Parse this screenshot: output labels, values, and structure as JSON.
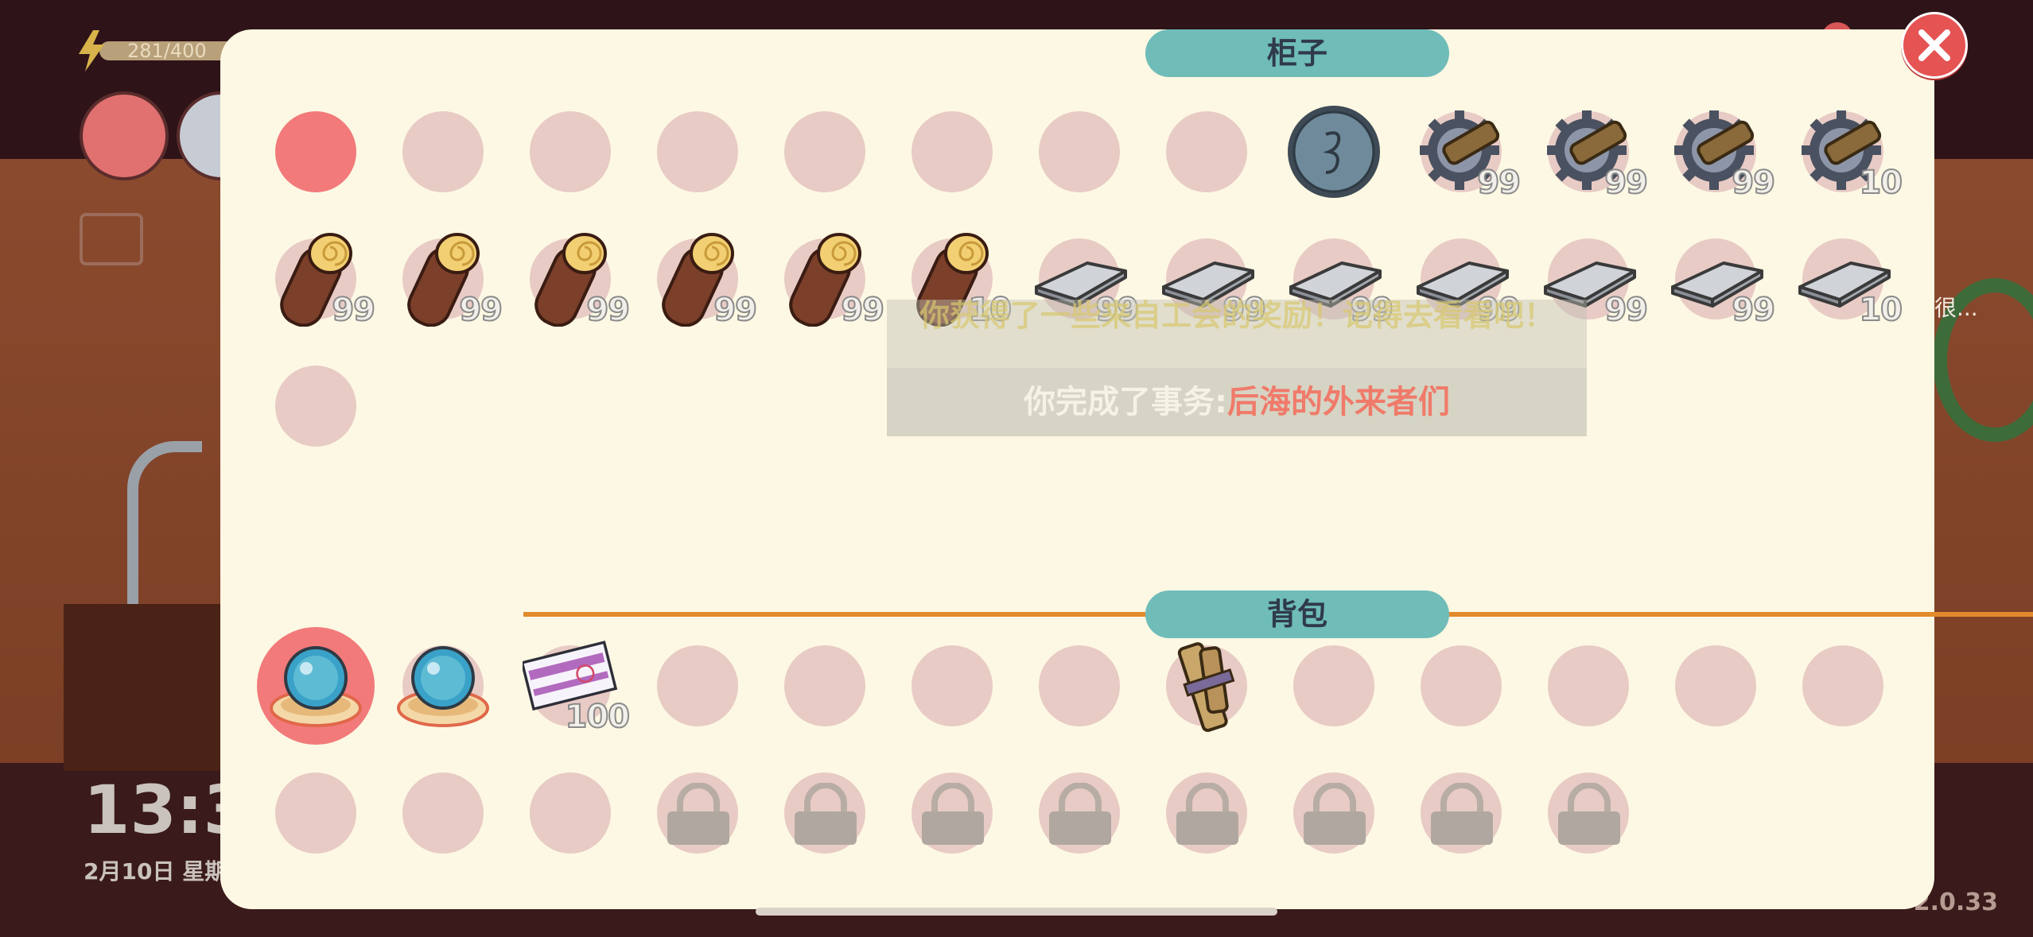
{
  "hud": {
    "energy_text": "281/400",
    "clock": "13:3",
    "date": "2月10日 星期",
    "version": "2.0.33",
    "side_hint": "很..."
  },
  "panel": {
    "chest_title": "柜子",
    "bag_title": "背包"
  },
  "chest_slots": [
    {
      "item": "empty-selected",
      "count": ""
    },
    {
      "item": "empty",
      "count": ""
    },
    {
      "item": "empty",
      "count": ""
    },
    {
      "item": "empty",
      "count": ""
    },
    {
      "item": "empty",
      "count": ""
    },
    {
      "item": "empty",
      "count": ""
    },
    {
      "item": "empty",
      "count": ""
    },
    {
      "item": "empty",
      "count": ""
    },
    {
      "item": "blue-coin",
      "count": ""
    },
    {
      "item": "gear",
      "count": "99"
    },
    {
      "item": "gear",
      "count": "99"
    },
    {
      "item": "gear",
      "count": "99"
    },
    {
      "item": "gear",
      "count": "10"
    },
    {
      "item": "log",
      "count": "99"
    },
    {
      "item": "log",
      "count": "99"
    },
    {
      "item": "log",
      "count": "99"
    },
    {
      "item": "log",
      "count": "99"
    },
    {
      "item": "log",
      "count": "99"
    },
    {
      "item": "log",
      "count": "10"
    },
    {
      "item": "metal-plate",
      "count": "99"
    },
    {
      "item": "metal-plate",
      "count": "99"
    },
    {
      "item": "metal-plate",
      "count": "99"
    },
    {
      "item": "metal-plate",
      "count": "99"
    },
    {
      "item": "metal-plate",
      "count": "99"
    },
    {
      "item": "metal-plate",
      "count": "99"
    },
    {
      "item": "metal-plate",
      "count": "10"
    },
    {
      "item": "empty",
      "count": ""
    }
  ],
  "bag_slots": [
    {
      "item": "crystal-ball",
      "count": "",
      "selected": true
    },
    {
      "item": "crystal-ball",
      "count": ""
    },
    {
      "item": "ticket",
      "count": "100"
    },
    {
      "item": "empty",
      "count": ""
    },
    {
      "item": "empty",
      "count": ""
    },
    {
      "item": "empty",
      "count": ""
    },
    {
      "item": "empty",
      "count": ""
    },
    {
      "item": "wood-bundle",
      "count": ""
    },
    {
      "item": "empty",
      "count": ""
    },
    {
      "item": "empty",
      "count": ""
    },
    {
      "item": "empty",
      "count": ""
    },
    {
      "item": "empty",
      "count": ""
    },
    {
      "item": "empty",
      "count": ""
    },
    {
      "item": "empty",
      "count": ""
    },
    {
      "item": "empty",
      "count": ""
    },
    {
      "item": "empty",
      "count": ""
    },
    {
      "item": "locked",
      "count": ""
    },
    {
      "item": "locked",
      "count": ""
    },
    {
      "item": "locked",
      "count": ""
    },
    {
      "item": "locked",
      "count": ""
    },
    {
      "item": "locked",
      "count": ""
    },
    {
      "item": "locked",
      "count": ""
    },
    {
      "item": "locked",
      "count": ""
    },
    {
      "item": "locked",
      "count": ""
    }
  ],
  "notification": {
    "top_text": "你获得了一些来自工会的奖励！记得去看看吧！",
    "prefix": "你完成了事务:",
    "quest_name": "后海的外来者们"
  },
  "colors": {
    "panel_bg": "#fdf8e3",
    "tab_bg": "#6fbcb9",
    "divider": "#e28b2d",
    "slot_empty": "#e8cbc5",
    "slot_selected": "#f27a7a",
    "close_button": "#e55353"
  }
}
